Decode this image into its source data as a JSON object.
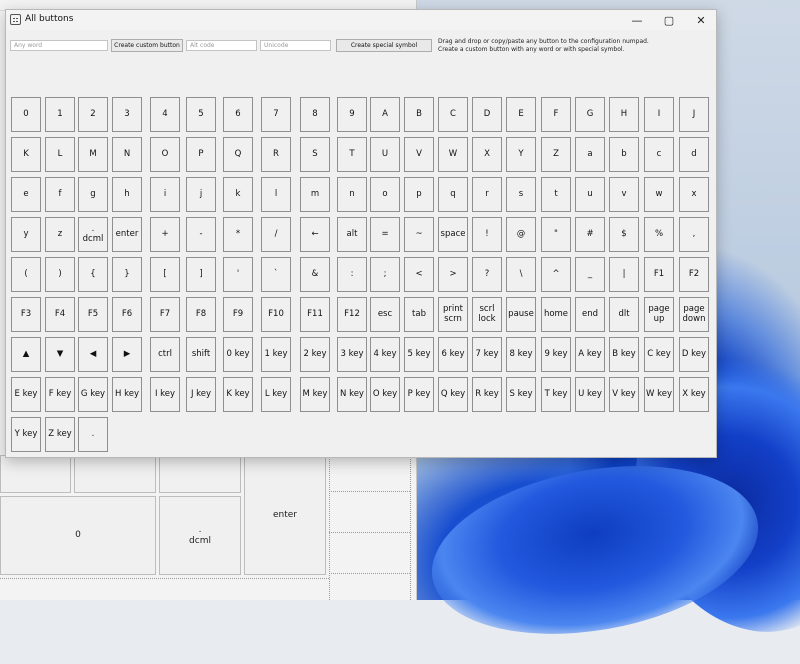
{
  "window": {
    "title": "All buttons"
  },
  "toolbar": {
    "any_word_placeholder": "Any word",
    "create_custom_label": "Create custom button",
    "alt_code_placeholder": "Alt code",
    "unicode_placeholder": "Unicode",
    "create_special_label": "Create special symbol",
    "hint_line1": "Drag and drop or copy/paste any button to the configuration numpad.",
    "hint_line2": "Create a custom button with any word or with special symbol."
  },
  "keys": [
    [
      "0",
      "1",
      "2",
      "3",
      "4",
      "5",
      "6",
      "7",
      "8",
      "9",
      "A",
      "B",
      "C",
      "D",
      "E",
      "F",
      "G",
      "H",
      "I",
      "J"
    ],
    [
      "K",
      "L",
      "M",
      "N",
      "O",
      "P",
      "Q",
      "R",
      "S",
      "T",
      "U",
      "V",
      "W",
      "X",
      "Y",
      "Z",
      "a",
      "b",
      "c",
      "d"
    ],
    [
      "e",
      "f",
      "g",
      "h",
      "i",
      "j",
      "k",
      "l",
      "m",
      "n",
      "o",
      "p",
      "q",
      "r",
      "s",
      "t",
      "u",
      "v",
      "w",
      "x"
    ],
    [
      "y",
      "z",
      ".\ndcml",
      "enter",
      "+",
      "-",
      "*",
      "/",
      "←",
      "alt",
      "=",
      "~",
      "space",
      "!",
      "@",
      "\"",
      "#",
      "$",
      "%",
      ","
    ],
    [
      "(",
      ")",
      "{",
      "}",
      "[",
      "]",
      "'",
      "`",
      "&",
      ":",
      ";",
      "<",
      ">",
      "?",
      "\\",
      "^",
      "_",
      "|",
      "F1",
      "F2"
    ],
    [
      "F3",
      "F4",
      "F5",
      "F6",
      "F7",
      "F8",
      "F9",
      "F10",
      "F11",
      "F12",
      "esc",
      "tab",
      "print\nscrn",
      "scrl\nlock",
      "pause",
      "home",
      "end",
      "dlt",
      "page\nup",
      "page\ndown"
    ],
    [
      "▲",
      "▼",
      "◀",
      "▶",
      "ctrl",
      "shift",
      "0 key",
      "1 key",
      "2 key",
      "3 key",
      "4 key",
      "5 key",
      "6 key",
      "7 key",
      "8 key",
      "9 key",
      "A key",
      "B key",
      "C key",
      "D key"
    ],
    [
      "E key",
      "F key",
      "G key",
      "H key",
      "I key",
      "J key",
      "K key",
      "L key",
      "M key",
      "N key",
      "O key",
      "P key",
      "Q key",
      "R key",
      "S key",
      "T key",
      "U key",
      "V key",
      "W key",
      "X key"
    ],
    [
      "Y key",
      "Z key",
      "."
    ]
  ],
  "background_window": {
    "enter_label": "enter",
    "zero_label": "0",
    "dcml_label": ".\ndcml"
  }
}
